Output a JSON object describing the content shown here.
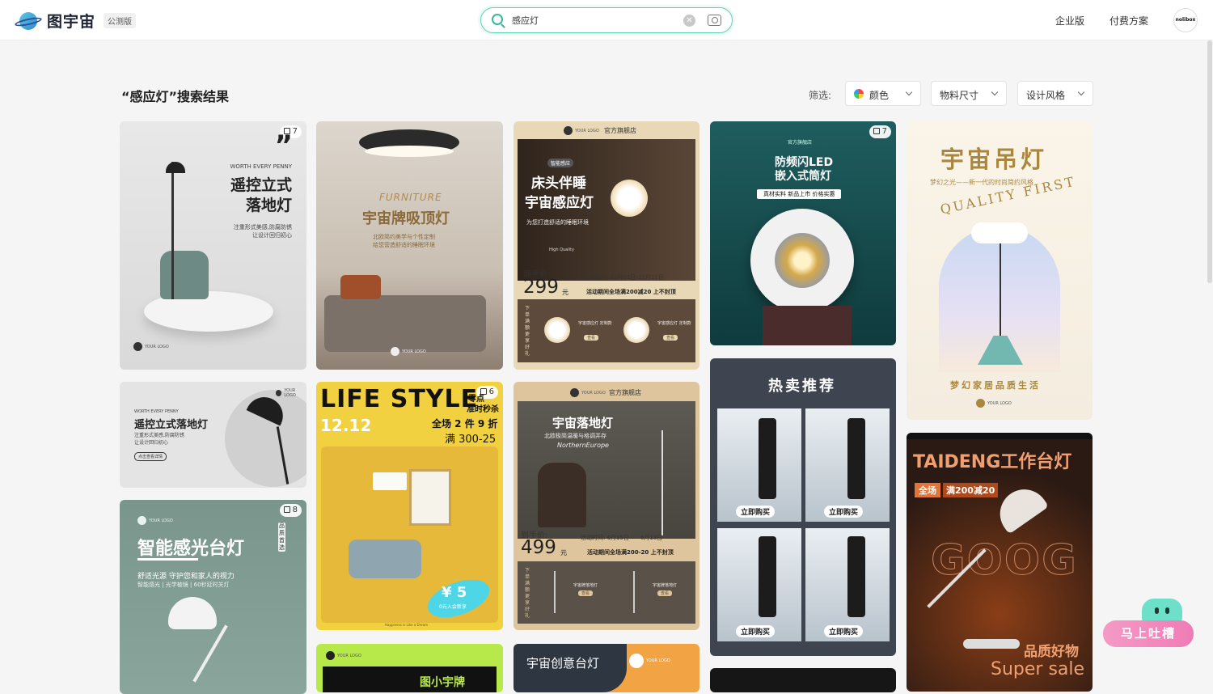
{
  "header": {
    "logo_text": "图宇宙",
    "beta": "公测版",
    "search_value": "感应灯",
    "search_placeholder": "",
    "nav": {
      "enterprise": "企业版",
      "pricing": "付费方案"
    },
    "avatar": "nolibox"
  },
  "results": {
    "title": "“感应灯”搜索结果",
    "filter_label": "筛选:",
    "filters": [
      "颜色",
      "物料尺寸",
      "设计风格"
    ]
  },
  "cards": {
    "c1": {
      "badge": "7",
      "quote": "”",
      "kicker": "WORTH EVERY PENNY",
      "title1": "遥控立式",
      "title2": "落地灯",
      "sub1": "注重形式美感,防腐防锈",
      "sub2": "让设计回归初心",
      "logo": "YOUR LOGO"
    },
    "c2": {
      "kicker": "FURNITURE",
      "title": "宇宙牌吸顶灯",
      "sub1": "北欧简约美学与个性定制",
      "sub2": "给您营造舒适的睡眠环境",
      "logo": "YOUR LOGO"
    },
    "c3": {
      "store": "官方旗舰店",
      "logo": "YOUR LOGO",
      "tag": "智能感应",
      "title1": "床头伴睡",
      "title2": "宇宙感应灯",
      "sub": "为您打造舒适的睡眠环境",
      "hq": "High Quality",
      "price_label": "到手价:",
      "price": "299",
      "unit": "元",
      "time": "活动时间: 11月01日-11月11日",
      "promo": "活动期间全场满200减20 上不封顶",
      "side": "下单满额更享好礼",
      "item1": "宇宙感应灯 定制款",
      "item2": "宇宙感应灯 定制款",
      "btn": "查看"
    },
    "c4": {
      "badge": "7",
      "store": "官方旗舰店",
      "title1": "防频闪LED",
      "title2": "嵌入式筒灯",
      "strip": "真材实料 新品上市 价格实惠"
    },
    "c5": {
      "title": "宇宙吊灯",
      "sub": "梦幻之光——新一代的时尚简约风格",
      "arc": "QUALITY FIRST",
      "slogan": "梦幻家居品质生活",
      "logo": "YOUR LOGO"
    },
    "c6": {
      "kicker": "WORTH EVERY PENNY",
      "title": "遥控立式落地灯",
      "sub1": "注重形式美感,防腐防锈",
      "sub2": "让设计回归初心",
      "btn": "点击查看详情",
      "logo": "YOUR LOGO"
    },
    "c7": {
      "badge": "6",
      "title": "LIFE STYLE",
      "date": "12.12",
      "flash1": "零点",
      "flash2": "准时秒杀",
      "deal1": "全场 2 件 9 折",
      "deal2": "满 300-25",
      "coupon": "¥ 5",
      "coupon_sub": "0元入会新享",
      "footer": "Happiness is Like a Dream"
    },
    "c8": {
      "store": "官方旗舰店",
      "logo": "YOUR LOGO",
      "title": "宇宙落地灯",
      "sub": "北欧极简温暖与格调并存",
      "script": "NorthernEurope",
      "price_label": "到手价:",
      "price": "499",
      "unit": "元",
      "time": "活动时间: 6月15日——6月18日",
      "promo": "活动期间全场满200-20 上不封顶",
      "side": "下单满额更享好礼",
      "item1": "宇宙牌落地灯",
      "item2": "宇宙牌落地灯",
      "btn": "查看"
    },
    "c9": {
      "title": "热卖推荐",
      "btn": "立即购买"
    },
    "c10": {
      "badge": "8",
      "logo": "YOUR LOGO",
      "title": "智能感光台灯",
      "side": "品质首选",
      "sub1": "舒适光源 守护您和家人的视力",
      "sub2": "智能感光 | 光学棱镜 | 60秒延时关灯"
    },
    "c11": {
      "logo": "YOUR LOGO",
      "title": "图小宇牌"
    },
    "c12": {
      "title": "宇宙创意台灯",
      "logo": "YOUR LOGO"
    },
    "c13": {
      "title": "TAIDENG工作台灯",
      "deal_a": "全场",
      "deal_b": "满200减20",
      "bg": "GOOG",
      "bottom1": "品质好物",
      "bottom2": "Super sale"
    }
  },
  "feedback": "马上吐槽"
}
